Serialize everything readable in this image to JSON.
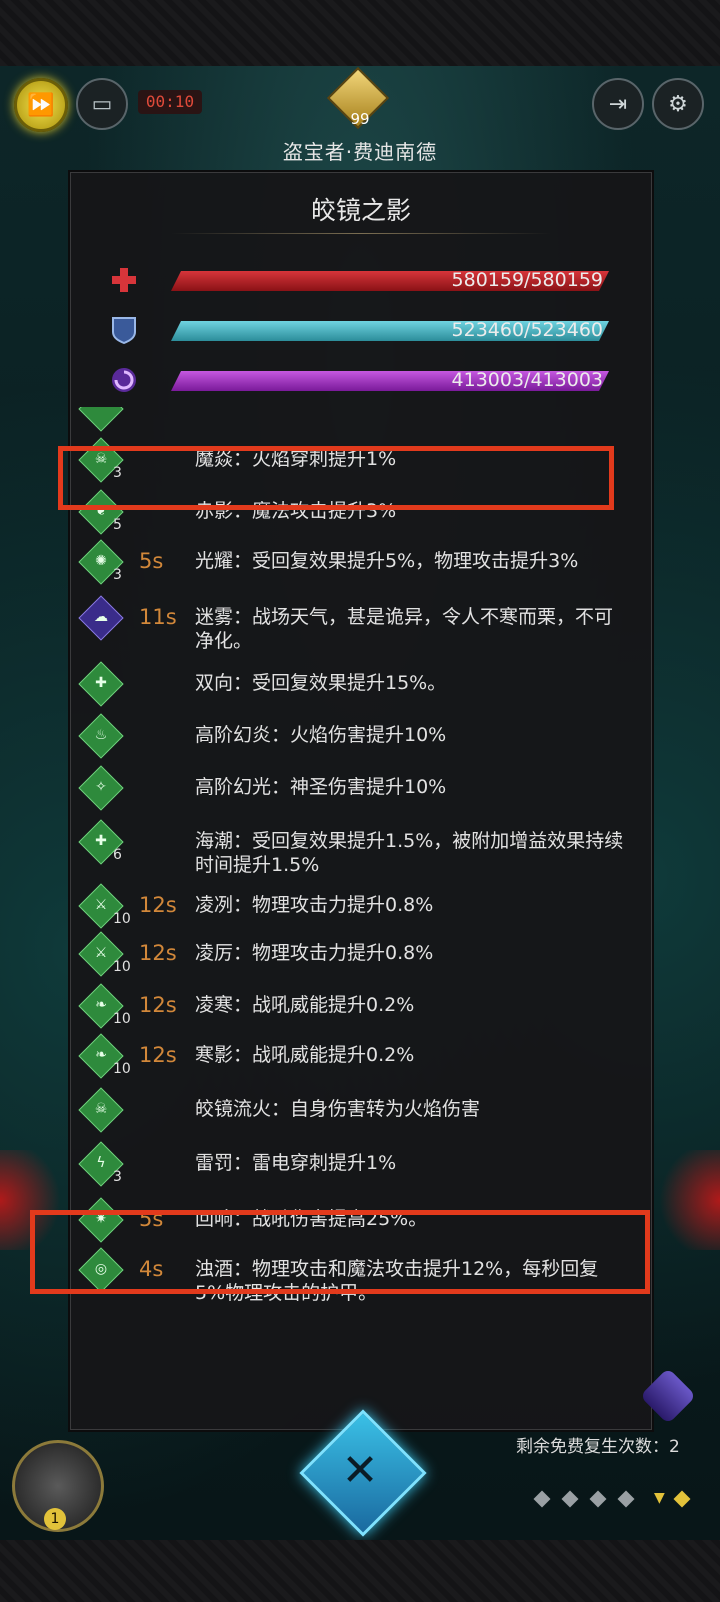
{
  "hud": {
    "timer": "00:10",
    "boss_level": "99",
    "boss_name": "盗宝者·费迪南德"
  },
  "panel": {
    "title": "皎镜之影",
    "stats": [
      {
        "type": "hp",
        "icon": "health-cross-icon",
        "value": "580159/580159",
        "color": "#d7353a",
        "fill": 1.0
      },
      {
        "type": "armor",
        "icon": "shield-icon",
        "value": "523460/523460",
        "color": "#6fd3e0",
        "fill": 1.0
      },
      {
        "type": "magic",
        "icon": "magic-swirl-icon",
        "value": "413003/413003",
        "color": "#c558e0",
        "fill": 1.0
      }
    ],
    "buffs": [
      {
        "icon": "fire-skull-icon",
        "stack": "3",
        "time": "",
        "text": "魔焱：火焰穿刺提升1%"
      },
      {
        "icon": "flame-claw-icon",
        "stack": "5",
        "time": "",
        "text": "赤影：魔法攻击提升3%"
      },
      {
        "icon": "sun-icon",
        "stack": "3",
        "time": "5s",
        "text": "光耀：受回复效果提升5%，物理攻击提升3%"
      },
      {
        "icon": "mist-icon",
        "stack": "",
        "time": "11s",
        "text": "迷雾：战场天气，甚是诡异，令人不寒而栗，不可净化。"
      },
      {
        "icon": "puzzle-icon",
        "stack": "",
        "time": "",
        "text": "双向：受回复效果提升15%。"
      },
      {
        "icon": "flame-icon",
        "stack": "",
        "time": "",
        "text": "高阶幻炎：火焰伤害提升10%"
      },
      {
        "icon": "light-icon",
        "stack": "",
        "time": "",
        "text": "高阶幻光：神圣伤害提升10%"
      },
      {
        "icon": "puzzle-icon",
        "stack": "6",
        "time": "",
        "text": "海潮：受回复效果提升1.5%，被附加增益效果持续时间提升1.5%"
      },
      {
        "icon": "sword-icon",
        "stack": "10",
        "time": "12s",
        "text": "凌冽：物理攻击力提升0.8%"
      },
      {
        "icon": "sword-icon",
        "stack": "10",
        "time": "12s",
        "text": "凌厉：物理攻击力提升0.8%"
      },
      {
        "icon": "claw-icon",
        "stack": "10",
        "time": "12s",
        "text": "凌寒：战吼威能提升0.2%"
      },
      {
        "icon": "claw-icon",
        "stack": "10",
        "time": "12s",
        "text": "寒影：战吼威能提升0.2%"
      },
      {
        "icon": "fire-skull-icon",
        "stack": "",
        "time": "",
        "text": "皎镜流火：自身伤害转为火焰伤害"
      },
      {
        "icon": "lightning-claw-icon",
        "stack": "3",
        "time": "",
        "text": "雷罚：雷电穿刺提升1%"
      },
      {
        "icon": "echo-icon",
        "stack": "",
        "time": "5s",
        "text": "回响：战吼伤害提高25%。"
      },
      {
        "icon": "spiral-icon",
        "stack": "",
        "time": "4s",
        "text": "浊酒：物理攻击和魔法攻击提升12%，每秒回复5%物理攻击的护甲。"
      }
    ]
  },
  "footer": {
    "revive_label": "剩余免费复生次数：2",
    "orb_count": "1"
  }
}
